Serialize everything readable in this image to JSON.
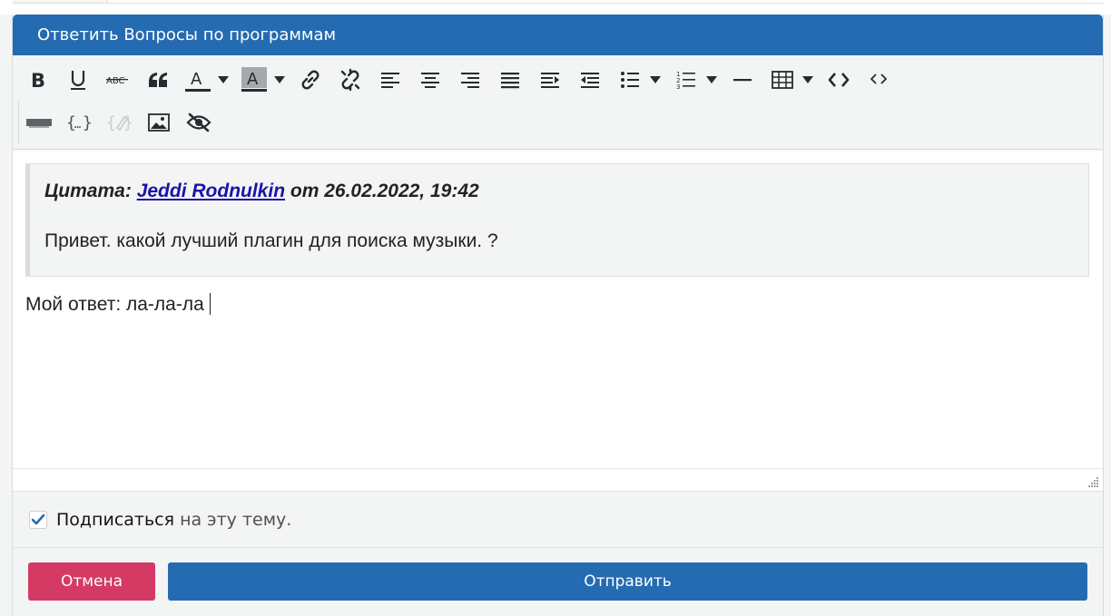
{
  "header": {
    "title": "Ответить Вопросы по программам"
  },
  "toolbar": {
    "row1": [
      {
        "name": "bold-button",
        "icon": "bold-icon"
      },
      {
        "name": "underline-button",
        "icon": "underline-icon"
      },
      {
        "name": "strikethrough-button",
        "icon": "strikethrough-icon"
      },
      {
        "name": "blockquote-button",
        "icon": "quote-icon"
      },
      {
        "name": "text-color-button",
        "icon": "text-color-icon"
      },
      {
        "name": "background-color-button",
        "icon": "background-color-icon"
      },
      {
        "name": "insert-link-button",
        "icon": "link-icon"
      },
      {
        "name": "remove-link-button",
        "icon": "unlink-icon"
      },
      {
        "name": "align-left-button",
        "icon": "align-left-icon"
      },
      {
        "name": "align-center-button",
        "icon": "align-center-icon"
      },
      {
        "name": "align-right-button",
        "icon": "align-right-icon"
      },
      {
        "name": "align-justify-button",
        "icon": "align-justify-icon"
      },
      {
        "name": "indent-button",
        "icon": "indent-icon"
      },
      {
        "name": "outdent-button",
        "icon": "outdent-icon"
      },
      {
        "name": "bullet-list-button",
        "icon": "bullet-list-icon"
      },
      {
        "name": "numbered-list-button",
        "icon": "numbered-list-icon"
      },
      {
        "name": "horizontal-rule-button",
        "icon": "horizontal-rule-icon"
      },
      {
        "name": "table-button",
        "icon": "table-icon"
      },
      {
        "name": "source-code-button",
        "icon": "code-icon"
      },
      {
        "name": "inline-code-button",
        "icon": "inline-code-icon"
      }
    ],
    "row2": [
      {
        "name": "spoiler-button",
        "icon": "spoiler-bar-icon"
      },
      {
        "name": "bbcode-button",
        "icon": "curly-braces-icon"
      },
      {
        "name": "remove-format-button",
        "icon": "eraser-icon"
      },
      {
        "name": "insert-image-button",
        "icon": "image-icon"
      },
      {
        "name": "hide-content-button",
        "icon": "eye-slash-icon"
      }
    ]
  },
  "editor": {
    "quote": {
      "label": "Цитата:",
      "author": "Jeddi Rodnulkin",
      "date_text": "от 26.02.2022, 19:42",
      "body": "Привет. какой лучший плагин для поиска музыки. ?"
    },
    "answer": "Мой ответ: ла-ла-ла"
  },
  "subscribe": {
    "checked": true,
    "label_strong": "Подписаться",
    "label_rest": "на эту тему."
  },
  "actions": {
    "cancel_label": "Отмена",
    "submit_label": "Отправить"
  },
  "colors": {
    "accent": "#256bb1",
    "cancel": "#d43a64",
    "quote_link": "#1a14a8"
  }
}
